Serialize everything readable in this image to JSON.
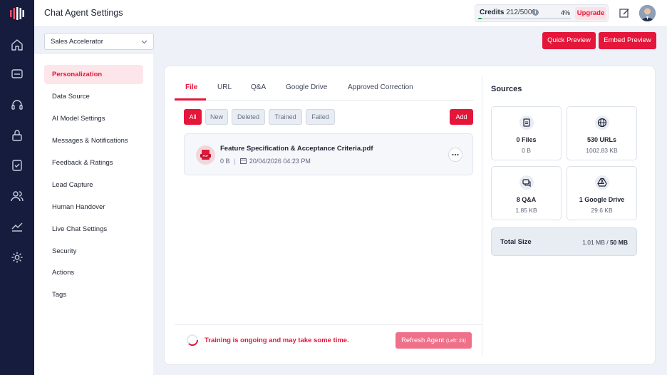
{
  "header": {
    "title": "Chat Agent Settings",
    "credits_label": "Credits",
    "credits_value": "212/5000",
    "credits_percent": "4%",
    "credits_fraction": 0.04,
    "upgrade_label": "Upgrade"
  },
  "subheader": {
    "agent_selected": "Sales Accelerator",
    "quick_preview": "Quick Preview",
    "embed_preview": "Embed Preview"
  },
  "nav": {
    "items": [
      {
        "label": "Personalization",
        "active": true
      },
      {
        "label": "Data Source"
      },
      {
        "label": "AI Model Settings"
      },
      {
        "label": "Messages & Notifications"
      },
      {
        "label": "Feedback & Ratings"
      },
      {
        "label": "Lead Capture"
      },
      {
        "label": "Human Handover"
      },
      {
        "label": "Live Chat Settings"
      },
      {
        "label": "Security"
      },
      {
        "label": "Actions"
      },
      {
        "label": "Tags"
      }
    ]
  },
  "tabs": [
    "File",
    "URL",
    "Q&A",
    "Google Drive",
    "Approved Correction"
  ],
  "filters": [
    "All",
    "New",
    "Deleted",
    "Trained",
    "Failed"
  ],
  "add_label": "Add",
  "file": {
    "name": "Feature Specification & Acceptance Criteria.pdf",
    "size": "0 B",
    "date": "20/04/2026 04:23 PM",
    "icon": "pdf-file-icon"
  },
  "footer": {
    "training_text": "Training is ongoing and may take some time.",
    "refresh_label": "Refresh Agent",
    "refresh_left": "(Left: 23)"
  },
  "sources": {
    "title": "Sources",
    "cards": [
      {
        "count": "0 Files",
        "size": "0 B",
        "icon": "file-icon"
      },
      {
        "count": "530 URLs",
        "size": "1002.83 KB",
        "icon": "globe-icon"
      },
      {
        "count": "8 Q&A",
        "size": "1.85 KB",
        "icon": "chat-icon"
      },
      {
        "count": "1 Google Drive",
        "size": "29.6 KB",
        "icon": "google-drive-icon"
      }
    ],
    "total_label": "Total Size",
    "total_used": "1.01 MB",
    "total_limit": "50 MB"
  },
  "colors": {
    "accent": "#e4163a",
    "rail": "#151c3d",
    "progress": "#1aa05a"
  }
}
